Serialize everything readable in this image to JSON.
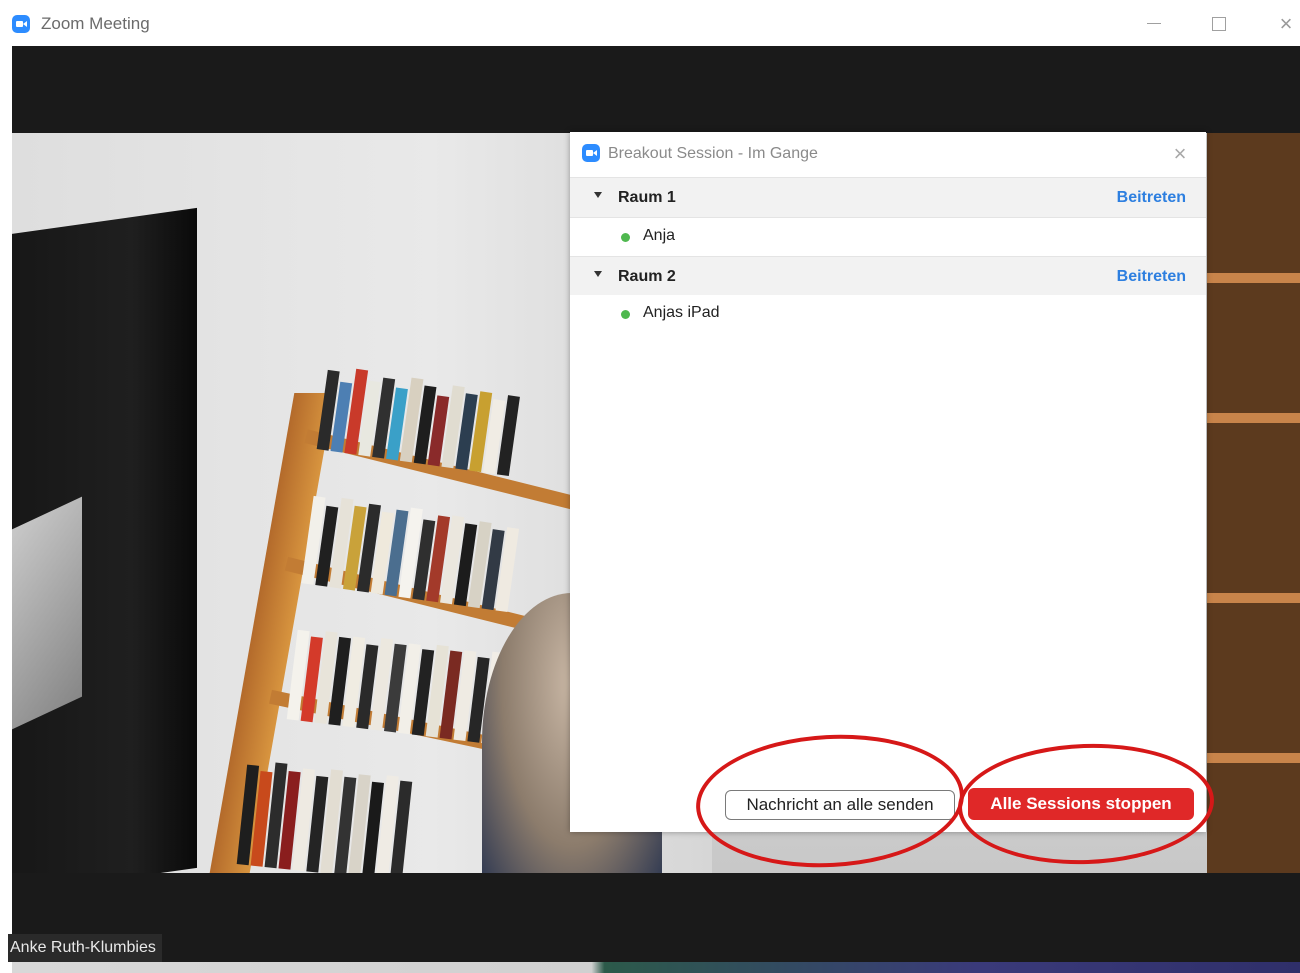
{
  "window": {
    "title": "Zoom Meeting",
    "minimize": "minimize",
    "maximize": "maximize",
    "close": "×"
  },
  "video": {
    "participant_name": "Anke Ruth-Klumbies"
  },
  "breakout_dialog": {
    "title": "Breakout Session - Im Gange",
    "close": "×",
    "rooms": [
      {
        "name": "Raum 1",
        "join_label": "Beitreten",
        "members": [
          "Anja"
        ]
      },
      {
        "name": "Raum 2",
        "join_label": "Beitreten",
        "members": [
          "Anjas iPad"
        ]
      }
    ],
    "broadcast_button": "Nachricht an alle senden",
    "stop_button": "Alle Sessions stoppen"
  },
  "colors": {
    "accent": "#2d8cff",
    "join_link": "#2d7fe0",
    "stop_button": "#e02828",
    "member_status": "#4fb84f",
    "annotation": "#d61818"
  }
}
